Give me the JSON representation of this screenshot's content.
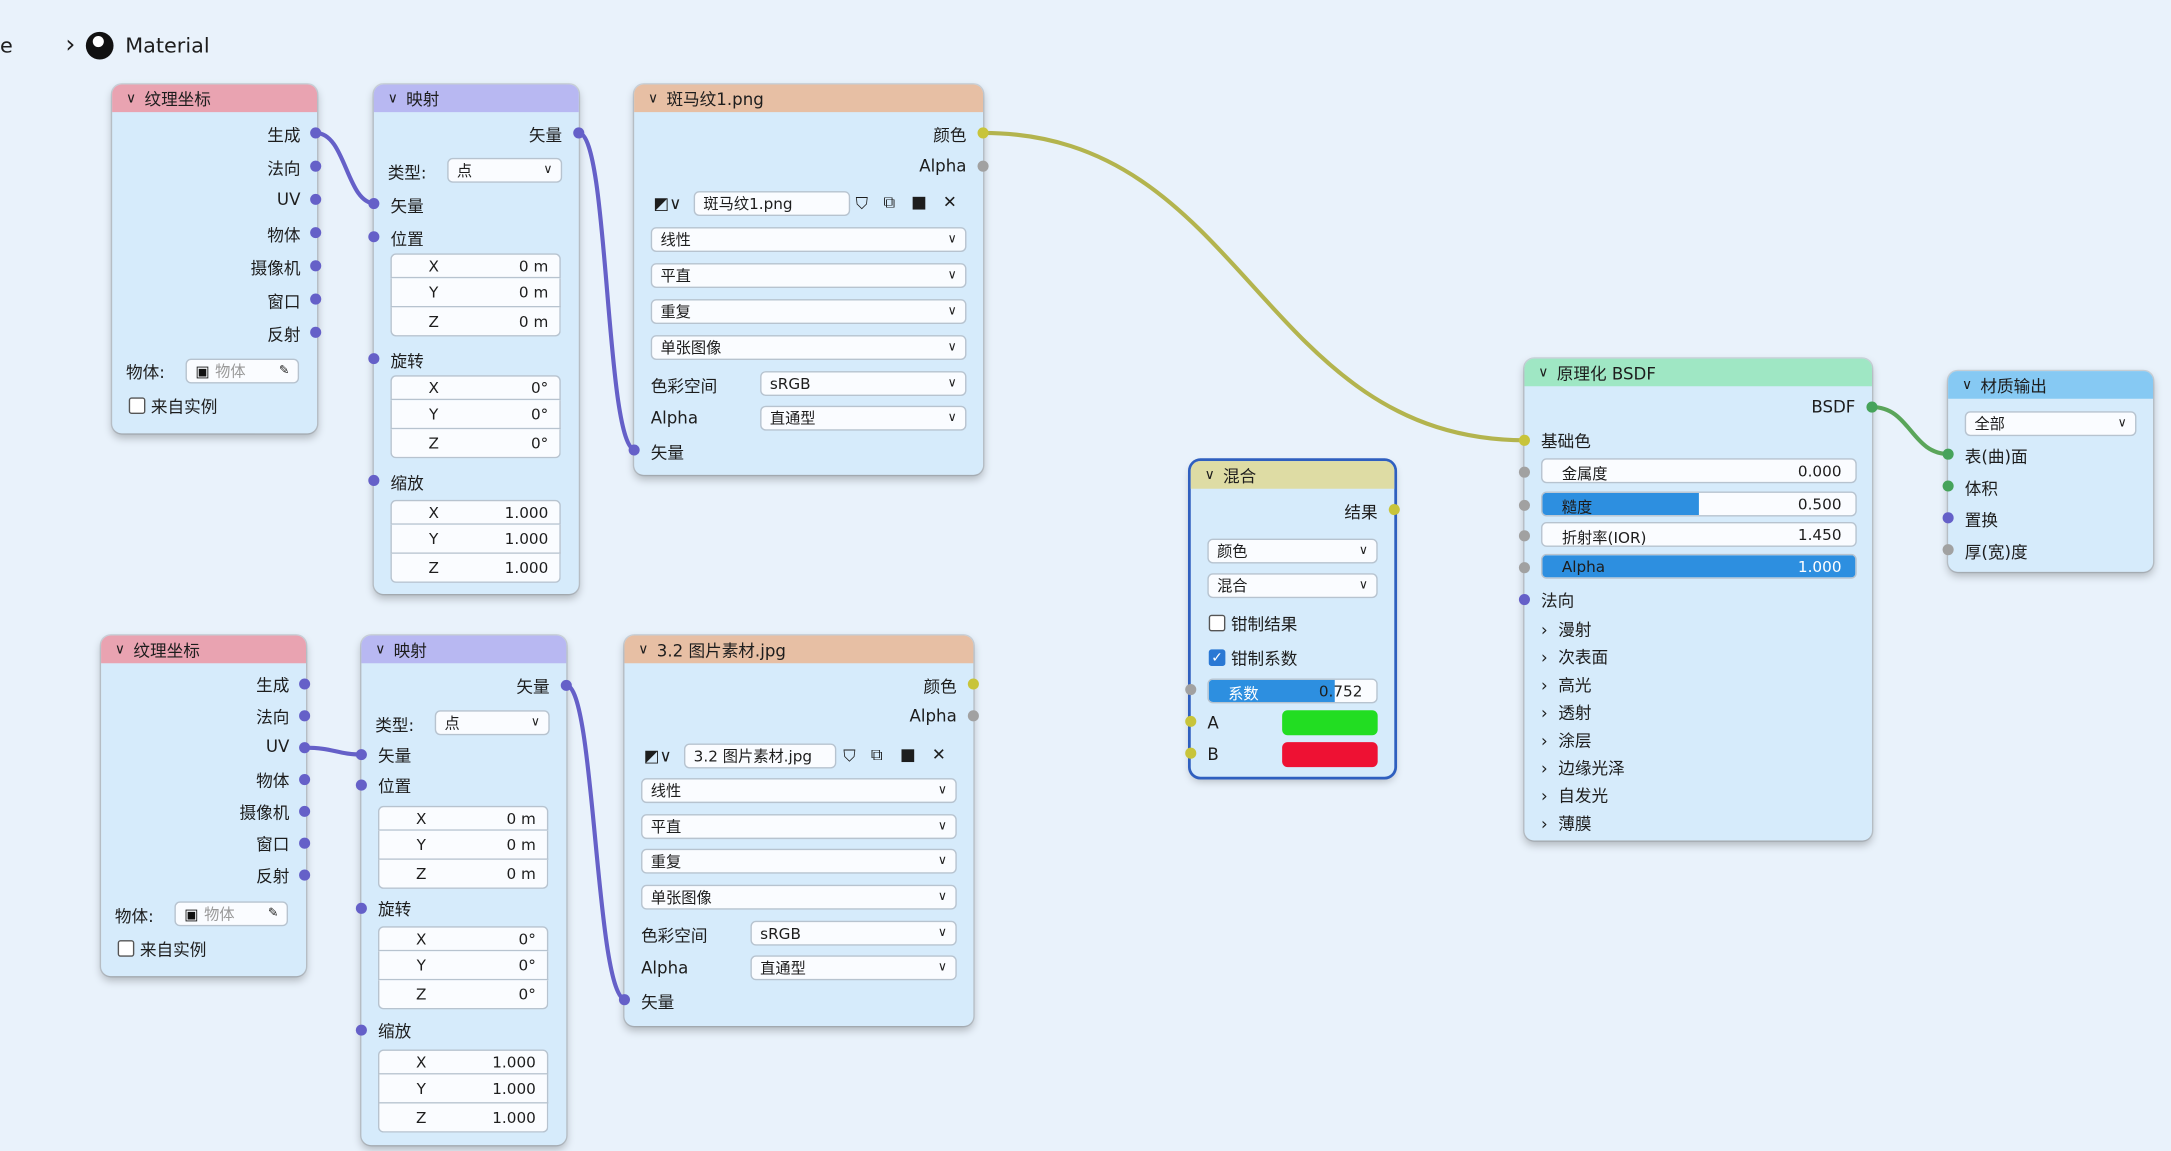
{
  "breadcrumb": {
    "prefix": "e",
    "separator": "›",
    "material_label": "Material"
  },
  "colors": {
    "vector_socket": "#6560c8",
    "color_socket": "#c8c43a",
    "float_socket": "#a1a1a1",
    "shader_socket": "#46a35a",
    "mix_a": "#22dd22",
    "mix_b": "#ee1133",
    "accent": "#2d8fe0"
  },
  "nodes": {
    "texcoord1": {
      "title": "纹理坐标",
      "outputs": [
        "生成",
        "法向",
        "UV",
        "物体",
        "摄像机",
        "窗口",
        "反射"
      ],
      "object_label": "物体:",
      "object_placeholder": "物体",
      "from_instancer": "来自实例"
    },
    "mapping1": {
      "title": "映射",
      "output": "矢量",
      "type_label": "类型:",
      "type_value": "点",
      "input_vector": "矢量",
      "location_label": "位置",
      "location": [
        {
          "axis": "X",
          "value": "0 m"
        },
        {
          "axis": "Y",
          "value": "0 m"
        },
        {
          "axis": "Z",
          "value": "0 m"
        }
      ],
      "rotation_label": "旋转",
      "rotation": [
        {
          "axis": "X",
          "value": "0°"
        },
        {
          "axis": "Y",
          "value": "0°"
        },
        {
          "axis": "Z",
          "value": "0°"
        }
      ],
      "scale_label": "缩放",
      "scale": [
        {
          "axis": "X",
          "value": "1.000"
        },
        {
          "axis": "Y",
          "value": "1.000"
        },
        {
          "axis": "Z",
          "value": "1.000"
        }
      ]
    },
    "image1": {
      "title": "斑马纹1.png",
      "out_color": "颜色",
      "out_alpha": "Alpha",
      "image_name": "斑马纹1.png",
      "interpolation": "线性",
      "projection": "平直",
      "extension": "重复",
      "source": "单张图像",
      "colorspace_label": "色彩空间",
      "colorspace": "sRGB",
      "alpha_label": "Alpha",
      "alpha_mode": "直通型",
      "input_vector": "矢量"
    },
    "texcoord2": {
      "title": "纹理坐标",
      "outputs": [
        "生成",
        "法向",
        "UV",
        "物体",
        "摄像机",
        "窗口",
        "反射"
      ],
      "object_label": "物体:",
      "object_placeholder": "物体",
      "from_instancer": "来自实例"
    },
    "mapping2": {
      "title": "映射",
      "output": "矢量",
      "type_label": "类型:",
      "type_value": "点",
      "input_vector": "矢量",
      "location_label": "位置",
      "location": [
        {
          "axis": "X",
          "value": "0 m"
        },
        {
          "axis": "Y",
          "value": "0 m"
        },
        {
          "axis": "Z",
          "value": "0 m"
        }
      ],
      "rotation_label": "旋转",
      "rotation": [
        {
          "axis": "X",
          "value": "0°"
        },
        {
          "axis": "Y",
          "value": "0°"
        },
        {
          "axis": "Z",
          "value": "0°"
        }
      ],
      "scale_label": "缩放",
      "scale": [
        {
          "axis": "X",
          "value": "1.000"
        },
        {
          "axis": "Y",
          "value": "1.000"
        },
        {
          "axis": "Z",
          "value": "1.000"
        }
      ]
    },
    "image2": {
      "title": "3.2 图片素材.jpg",
      "out_color": "颜色",
      "out_alpha": "Alpha",
      "image_name": "3.2 图片素材.jpg",
      "interpolation": "线性",
      "projection": "平直",
      "extension": "重复",
      "source": "单张图像",
      "colorspace_label": "色彩空间",
      "colorspace": "sRGB",
      "alpha_label": "Alpha",
      "alpha_mode": "直通型",
      "input_vector": "矢量"
    },
    "mix": {
      "title": "混合",
      "output": "结果",
      "data_type": "颜色",
      "blend_mode": "混合",
      "clamp_result": "钳制结果",
      "clamp_factor": "钳制系数",
      "factor_label": "系数",
      "factor_value": "0.752",
      "factor_fraction": 0.752,
      "input_a": "A",
      "input_b": "B"
    },
    "bsdf": {
      "title": "原理化 BSDF",
      "output": "BSDF",
      "base_color": "基础色",
      "metallic_label": "金属度",
      "metallic_value": "0.000",
      "metallic_fraction": 0.0,
      "roughness_label": "糙度",
      "roughness_value": "0.500",
      "roughness_fraction": 0.5,
      "ior_label": "折射率(IOR)",
      "ior_value": "1.450",
      "alpha_label": "Alpha",
      "alpha_value": "1.000",
      "alpha_fraction": 1.0,
      "normal": "法向",
      "panels": [
        "漫射",
        "次表面",
        "高光",
        "透射",
        "涂层",
        "边缘光泽",
        "自发光",
        "薄膜"
      ]
    },
    "output": {
      "title": "材质输出",
      "target": "全部",
      "inputs": [
        "表(曲)面",
        "体积",
        "置换",
        "厚(宽)度"
      ]
    }
  }
}
